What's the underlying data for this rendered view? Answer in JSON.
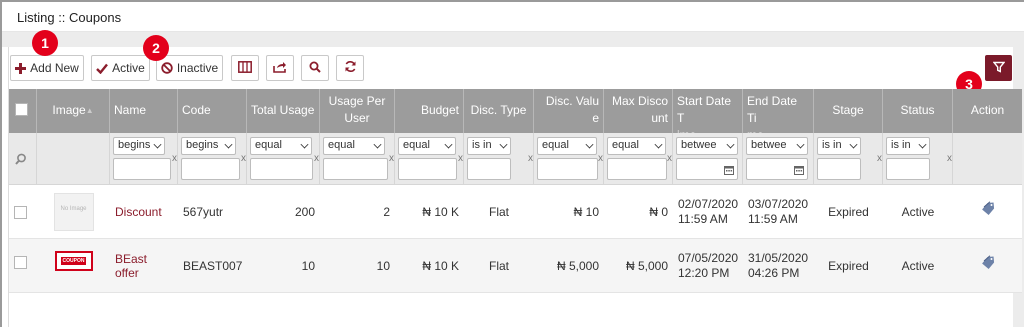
{
  "page": {
    "title": "Listing :: Coupons"
  },
  "toolbar": {
    "add_new": "Add New",
    "active": "Active",
    "inactive": "Inactive"
  },
  "badges": [
    "1",
    "2",
    "3"
  ],
  "colors": {
    "accent": "#8b1d2c",
    "header_bg": "#9c9c9c",
    "filter_bg": "#e9e9e9",
    "badge": "#e3001b"
  },
  "table": {
    "headers": {
      "image": "Image",
      "name": "Name",
      "code": "Code",
      "total_usage": "Total Usage",
      "usage_per_user_1": "Usage Per",
      "usage_per_user_2": "User",
      "budget": "Budget",
      "disc_type": "Disc. Type",
      "disc_value_1": "Disc. Valu",
      "disc_value_2": "e",
      "max_discount_1": "Max Disco",
      "max_discount_2": "unt",
      "start_1": "Start Date T",
      "start_2": "ime",
      "end_1": "End Date Ti",
      "end_2": "me",
      "stage": "Stage",
      "status": "Status",
      "action": "Action"
    },
    "filters": {
      "name": "begins",
      "code": "begins",
      "total_usage": "equal",
      "usage_per_user": "equal",
      "budget": "equal",
      "disc_type": "is in",
      "disc_value": "equal",
      "max_discount": "equal",
      "start": "betwee",
      "end": "betwee",
      "stage": "is in",
      "status": "is in",
      "clear": "x"
    },
    "rows": [
      {
        "image_text": "No Image",
        "name": "Discount",
        "code": "567yutr",
        "total_usage": "200",
        "usage_per_user": "2",
        "budget": "₦ 10 K",
        "disc_type": "Flat",
        "disc_value": "₦ 10",
        "max_discount": "₦ 0",
        "start_date": "02/07/2020",
        "start_time": "11:59 AM",
        "end_date": "03/07/2020",
        "end_time": "11:59 AM",
        "stage": "Expired",
        "status": "Active"
      },
      {
        "image_text": "COUPON",
        "name": "BEast offer",
        "code": "BEAST007",
        "total_usage": "10",
        "usage_per_user": "10",
        "budget": "₦ 10 K",
        "disc_type": "Flat",
        "disc_value": "₦ 5,000",
        "max_discount": "₦ 5,000",
        "start_date": "07/05/2020",
        "start_time": "12:20 PM",
        "end_date": "31/05/2020",
        "end_time": "04:26 PM",
        "stage": "Expired",
        "status": "Active"
      }
    ]
  }
}
